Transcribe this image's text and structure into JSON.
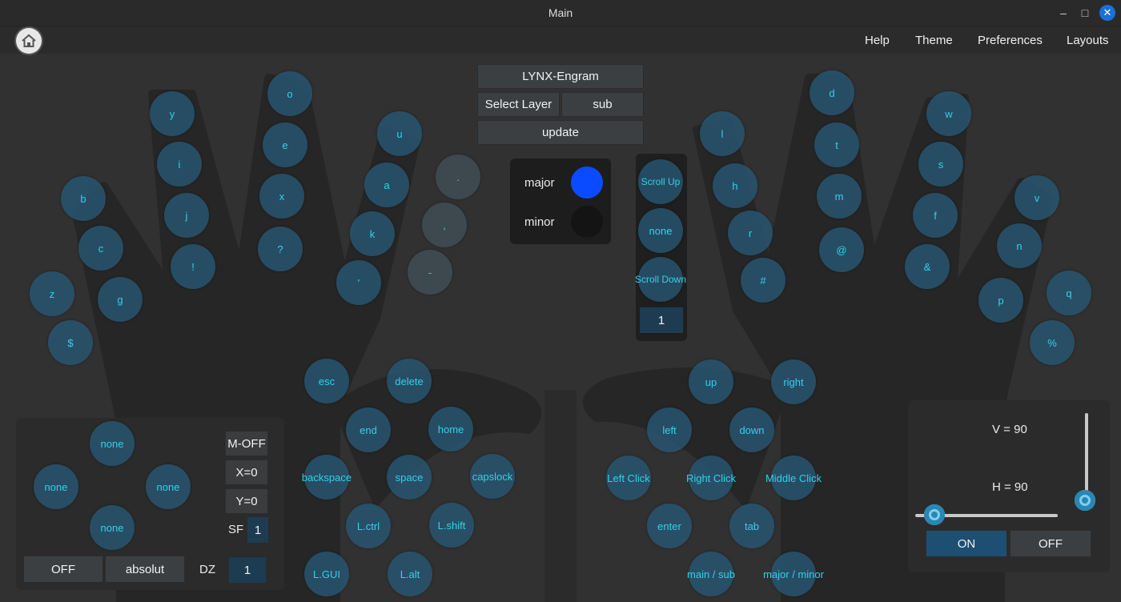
{
  "window": {
    "title": "Main",
    "minimize_glyph": "–",
    "maximize_glyph": "□",
    "close_glyph": "✕"
  },
  "menu": {
    "help": "Help",
    "theme": "Theme",
    "preferences": "Preferences",
    "layouts": "Layouts"
  },
  "layout": {
    "name": "LYNX-Engram",
    "select_layer": "Select Layer",
    "layer_value": "sub",
    "update": "update"
  },
  "mode": {
    "major": "major",
    "minor": "minor",
    "major_color": "#0a4bff",
    "minor_color": "#141414"
  },
  "scroll": {
    "up": "Scroll Up",
    "mid": "none",
    "down": "Scroll Down",
    "value": "1"
  },
  "left_letters": {
    "b": "b",
    "c": "c",
    "z": "z",
    "dollar": "$",
    "y": "y",
    "i": "i",
    "j": "j",
    "excl": "!",
    "g": "g",
    "o": "o",
    "e": "e",
    "x": "x",
    "q": "?",
    "u": "u",
    "a": "a",
    "k": "k",
    "apos": "'",
    "period": ".",
    "comma": ",",
    "dash": "-"
  },
  "right_letters": {
    "l": "l",
    "h": "h",
    "r": "r",
    "hash": "#",
    "d": "d",
    "t": "t",
    "m": "m",
    "at": "@",
    "w": "w",
    "s": "s",
    "f": "f",
    "amp": "&",
    "v": "v",
    "n": "n",
    "p": "p",
    "q": "q",
    "pct": "%"
  },
  "left_thumb": {
    "esc": "esc",
    "delete": "delete",
    "end": "end",
    "home": "home",
    "backspace": "backspace",
    "space": "space",
    "capslock": "capslock",
    "lctrl": "L.ctrl",
    "lshift": "L.shift",
    "lgui": "L.GUI",
    "lalt": "L.alt"
  },
  "right_thumb": {
    "up": "up",
    "right": "right",
    "left": "left",
    "down": "down",
    "left_click": "Left Click",
    "right_click": "Right Click",
    "middle_click": "Middle Click",
    "enter": "enter",
    "tab": "tab",
    "main_sub": "main / sub",
    "major_minor": "major / minor"
  },
  "joystick": {
    "up": "none",
    "left": "none",
    "right": "none",
    "down": "none",
    "moff": "M-OFF",
    "x": "X=0",
    "y": "Y=0",
    "sf_label": "SF",
    "sf_value": "1",
    "off": "OFF",
    "absolut": "absolut",
    "dz_label": "DZ",
    "dz_value": "1"
  },
  "servo": {
    "v_label": "V = 90",
    "h_label": "H = 90",
    "on": "ON",
    "off": "OFF",
    "v_value": 90,
    "h_value": 90
  }
}
